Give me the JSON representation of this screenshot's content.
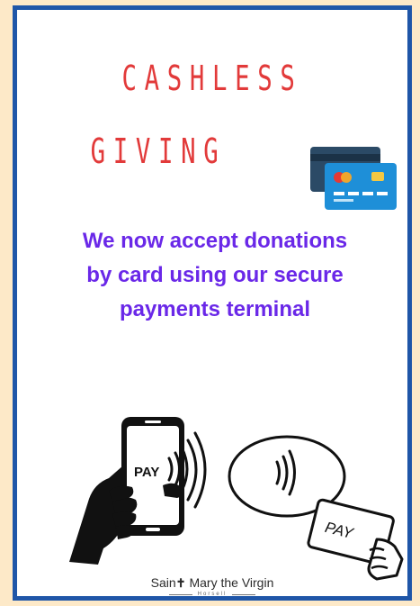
{
  "poster": {
    "title_line1": "CASHLESS",
    "title_line2": "GIVING",
    "message_lines": [
      "We now accept donations",
      "by card using our secure",
      "payments terminal"
    ],
    "phone_label": "PAY",
    "card_label": "PAY",
    "footer": {
      "brand_part1": "Sain",
      "brand_cross": "✝",
      "brand_part2": " Mary the Virgin",
      "subtitle": "Horsell"
    }
  },
  "colors": {
    "background": "#fde9c8",
    "border": "#1f56a8",
    "title": "#e23a3a",
    "message": "#6a28e8",
    "card_front": "#1e8fd8",
    "card_back": "#2b4a66"
  },
  "icons": {
    "card": "credit-card-icon",
    "phone": "contactless-phone-icon",
    "terminal": "contactless-card-icon"
  }
}
